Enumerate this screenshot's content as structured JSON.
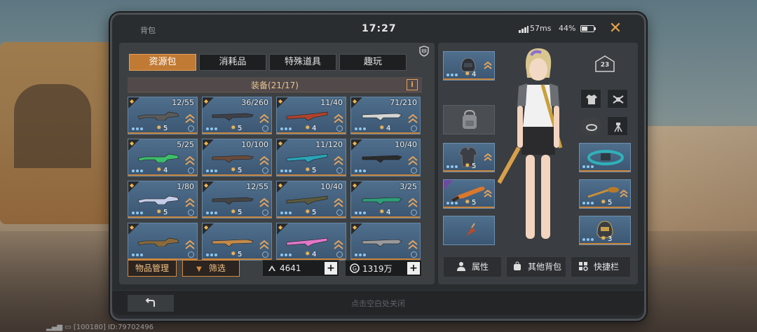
{
  "header": {
    "title": "背包",
    "time": "17:27",
    "ping": "57ms",
    "battery": "44%"
  },
  "tabs": [
    {
      "label": "资源包",
      "active": true
    },
    {
      "label": "消耗品",
      "active": false
    },
    {
      "label": "特殊道具",
      "active": false
    },
    {
      "label": "趣玩",
      "active": false
    }
  ],
  "equipment": {
    "title": "装备(21/17)",
    "info_label": "i"
  },
  "slots": [
    {
      "ammo": "12/55",
      "level": "5",
      "color": "#5a5a5a"
    },
    {
      "ammo": "36/260",
      "level": "5",
      "color": "#3f3f46"
    },
    {
      "ammo": "11/40",
      "level": "4",
      "color": "#b0422c"
    },
    {
      "ammo": "71/210",
      "level": "4",
      "color": "#d5d5d5"
    },
    {
      "ammo": "5/25",
      "level": "4",
      "color": "#3ebd6a"
    },
    {
      "ammo": "10/100",
      "level": "5",
      "color": "#6a4a3a"
    },
    {
      "ammo": "11/120",
      "level": "5",
      "color": "#2aa4b8"
    },
    {
      "ammo": "10/40",
      "level": "",
      "color": "#2b2b2b"
    },
    {
      "ammo": "1/80",
      "level": "5",
      "color": "#c6cde8"
    },
    {
      "ammo": "12/55",
      "level": "5",
      "color": "#444"
    },
    {
      "ammo": "10/40",
      "level": "5",
      "color": "#5b5a3c"
    },
    {
      "ammo": "3/25",
      "level": "4",
      "color": "#2f9e78"
    },
    {
      "ammo": "",
      "level": "",
      "color": "#8a6a3a"
    },
    {
      "ammo": "",
      "level": "5",
      "color": "#c28a4a"
    },
    {
      "ammo": "",
      "level": "4",
      "color": "#e077c7"
    },
    {
      "ammo": "",
      "level": "",
      "color": "#9a9a9a"
    }
  ],
  "controls": {
    "manage": "物品管理",
    "filter": "筛选",
    "bonds": "4641",
    "coins": "1319万"
  },
  "character": {
    "level": "23",
    "slots": [
      {
        "id": "helmet-top",
        "level": "4"
      },
      {
        "id": "armor",
        "level": "5"
      },
      {
        "id": "melee",
        "level": "5"
      },
      {
        "id": "sling",
        "level": ""
      },
      {
        "id": "belt",
        "level": ""
      },
      {
        "id": "pan",
        "level": "5"
      },
      {
        "id": "helmet",
        "level": "3"
      }
    ],
    "buttons": {
      "attributes": "属性",
      "other_bags": "其他背包",
      "quickbar": "快捷栏"
    }
  },
  "footer": {
    "hint": "点击空白处关闭"
  },
  "system": {
    "id_text": "[100180] ID:79702496"
  },
  "colors": {
    "accent": "#c17a33",
    "slot_blue": "#4f6f8d",
    "gold": "#e8b55c"
  }
}
